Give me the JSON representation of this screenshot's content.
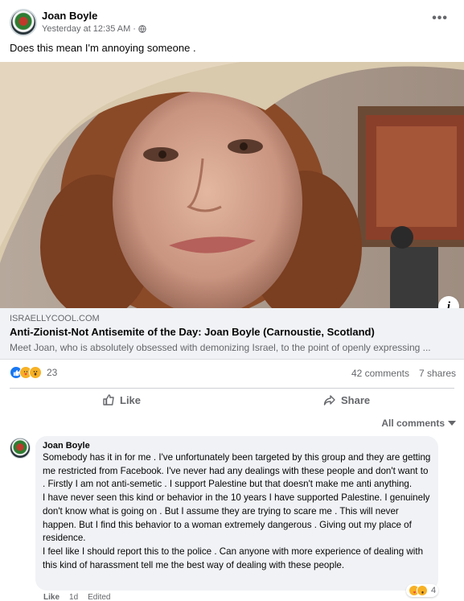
{
  "post": {
    "author": "Joan Boyle",
    "timestamp": "Yesterday at 12:35 AM",
    "separator": "·",
    "more_label": "•••",
    "text": "Does this mean I'm annoying someone ."
  },
  "link": {
    "domain": "ISRAELLYCOOL.COM",
    "title": "Anti-Zionist-Not Antisemite of the Day: Joan Boyle (Carnoustie, Scotland)",
    "description": "Meet Joan, who is absolutely obsessed with demonizing Israel, to the point of openly expressing ...",
    "info_label": "i"
  },
  "stats": {
    "reaction_count": "23",
    "comments": "42 comments",
    "shares": "7 shares"
  },
  "actions": {
    "like_label": "Like",
    "share_label": "Share"
  },
  "filter": {
    "label": "All comments"
  },
  "comment": {
    "author": "Joan Boyle",
    "text": "Somebody has it in for me . I've unfortunately been targeted by this group and they are getting me restricted from Facebook. I've never had any dealings with these people and don't want to . Firstly I am not anti-semetic . I support Palestine but that doesn't make me anti anything.\nI have never seen this kind or behavior in the 10 years I have supported Palestine. I genuinely don't know what is going on . But I assume they are trying to scare me . This will never happen. But I find this behavior to a woman extremely dangerous . Giving out my place of residence.\nI feel like I should report this to the police . Can anyone with more experience of dealing with this kind of harassment tell me the best way of dealing with these people.",
    "reaction_count": "4",
    "like_label": "Like",
    "age": "1d",
    "edited": "Edited"
  },
  "icons": [
    "profile-avatar",
    "globe-icon",
    "more-icon",
    "info-icon",
    "like-reaction-icon",
    "care-reaction-icon",
    "wow-reaction-icon",
    "thumbs-up-icon",
    "share-arrow-icon",
    "caret-down-icon"
  ],
  "colors": {
    "accent": "#1877f2",
    "secondary_text": "#65676b",
    "surface": "#f0f2f5"
  }
}
